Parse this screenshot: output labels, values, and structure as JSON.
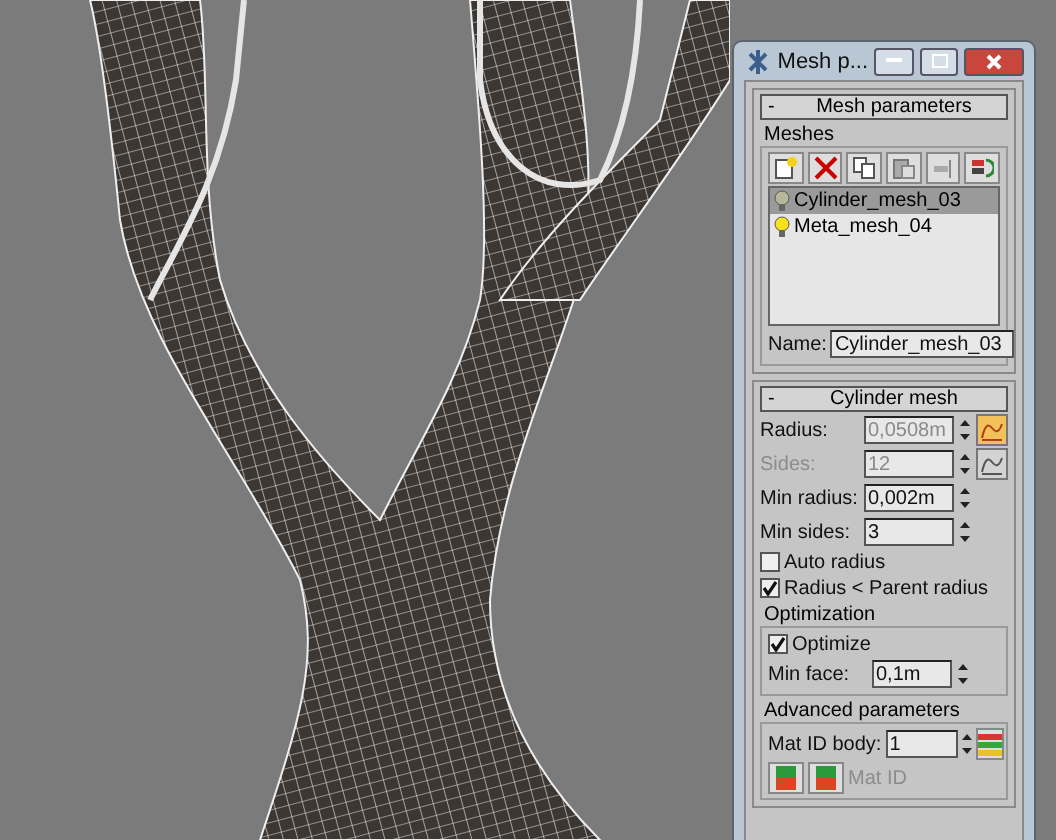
{
  "window": {
    "title": "Mesh p..."
  },
  "mesh_parameters": {
    "collapse": "-",
    "title": "Mesh parameters",
    "group": "Meshes",
    "meshes": [
      {
        "label": "Cylinder_mesh_03",
        "selected": true,
        "lit": false
      },
      {
        "label": "Meta_mesh_04",
        "selected": false,
        "lit": true
      }
    ],
    "name_label": "Name:",
    "name_value": "Cylinder_mesh_03"
  },
  "cylinder_mesh": {
    "collapse": "-",
    "title": "Cylinder mesh",
    "fields": [
      {
        "label": "Radius:",
        "value": "0,0508m",
        "disabled": false,
        "value_disabled": true,
        "curve_active": true
      },
      {
        "label": "Sides:",
        "value": "12",
        "disabled": true,
        "value_disabled": true,
        "curve_active": false
      },
      {
        "label": "Min radius:",
        "value": "0,002m",
        "disabled": false,
        "value_disabled": false
      },
      {
        "label": "Min sides:",
        "value": "3",
        "disabled": false,
        "value_disabled": false
      }
    ],
    "checkboxes": [
      {
        "label": "Auto radius",
        "checked": false
      },
      {
        "label": "Radius < Parent radius",
        "checked": true
      }
    ],
    "optimization": {
      "title": "Optimization",
      "checkbox": {
        "label": "Optimize",
        "checked": true
      },
      "min_face_label": "Min face:",
      "min_face_value": "0,1m"
    },
    "advanced": {
      "title": "Advanced parameters",
      "mat_id_label": "Mat ID body:",
      "mat_id_value": "1",
      "mat_id_caption": "Mat ID"
    }
  }
}
